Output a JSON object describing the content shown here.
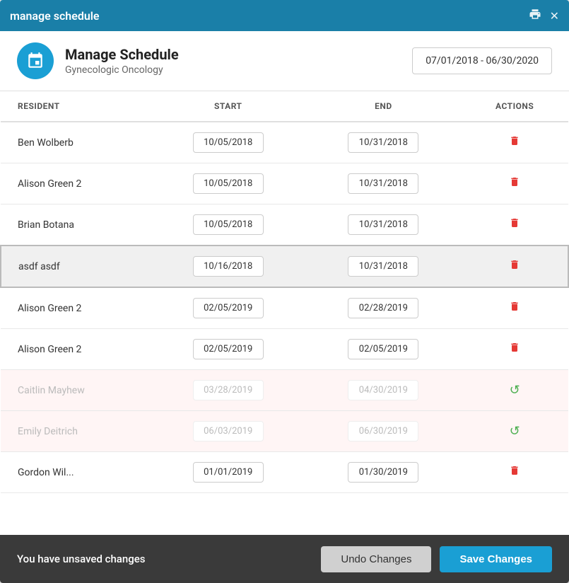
{
  "titleBar": {
    "title": "manage schedule",
    "printIcon": "🖨",
    "closeIcon": "✕"
  },
  "header": {
    "title": "Manage Schedule",
    "subtitle": "Gynecologic Oncology",
    "dateRange": "07/01/2018 - 06/30/2020"
  },
  "table": {
    "columns": {
      "resident": "RESIDENT",
      "start": "START",
      "end": "END",
      "actions": "ACTIONS"
    },
    "rows": [
      {
        "id": 1,
        "resident": "Ben Wolberb",
        "start": "10/05/2018",
        "end": "10/31/2018",
        "state": "normal"
      },
      {
        "id": 2,
        "resident": "Alison Green 2",
        "start": "10/05/2018",
        "end": "10/31/2018",
        "state": "normal"
      },
      {
        "id": 3,
        "resident": "Brian Botana",
        "start": "10/05/2018",
        "end": "10/31/2018",
        "state": "normal"
      },
      {
        "id": 4,
        "resident": "asdf asdf",
        "start": "10/16/2018",
        "end": "10/31/2018",
        "state": "highlighted"
      },
      {
        "id": 5,
        "resident": "Alison Green 2",
        "start": "02/05/2019",
        "end": "02/28/2019",
        "state": "normal"
      },
      {
        "id": 6,
        "resident": "Alison Green 2",
        "start": "02/05/2019",
        "end": "02/05/2019",
        "state": "normal"
      },
      {
        "id": 7,
        "resident": "Caitlin Mayhew",
        "start": "03/28/2019",
        "end": "04/30/2019",
        "state": "deleted"
      },
      {
        "id": 8,
        "resident": "Emily Deitrich",
        "start": "06/03/2019",
        "end": "06/30/2019",
        "state": "deleted"
      },
      {
        "id": 9,
        "resident": "Gordon Wil...",
        "start": "01/01/2019",
        "end": "01/30/2019",
        "state": "normal"
      }
    ]
  },
  "footer": {
    "message": "You have unsaved changes",
    "undoLabel": "Undo Changes",
    "saveLabel": "Save Changes"
  }
}
